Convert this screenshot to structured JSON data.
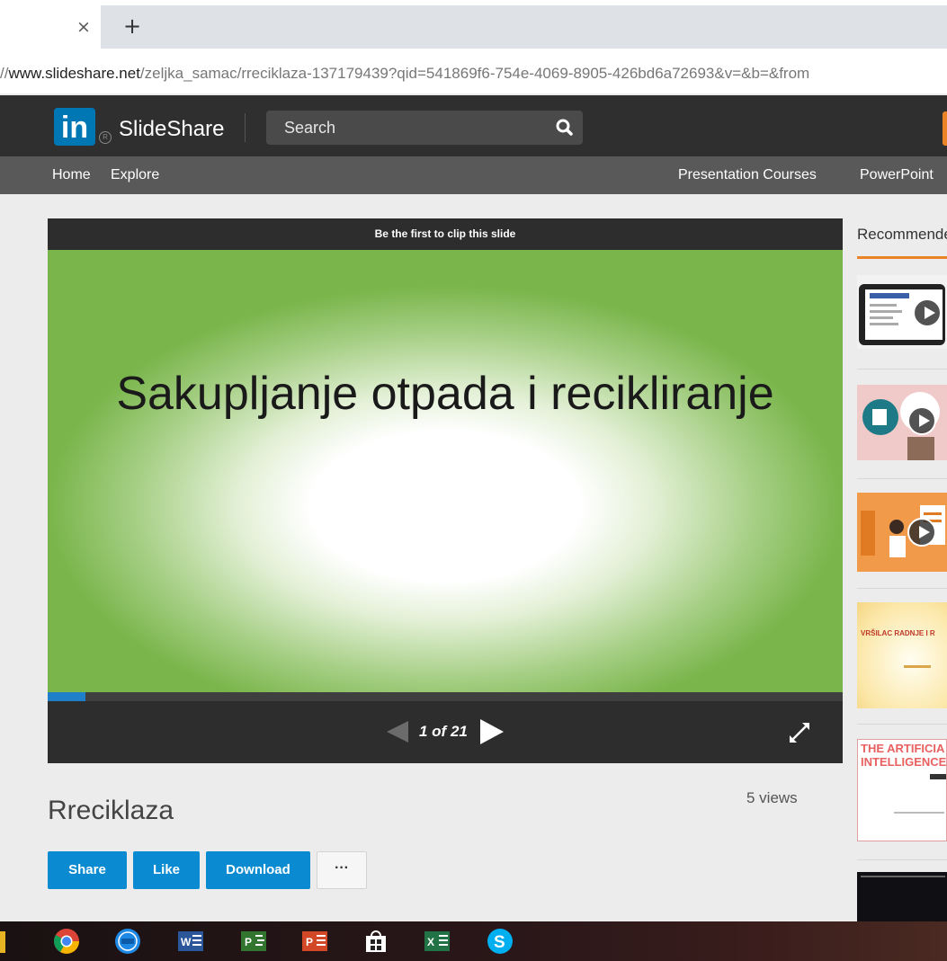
{
  "browser": {
    "tab_close_glyph": "×",
    "new_tab_glyph": "+",
    "url_prefix": "//",
    "url_domain": "www.slideshare.net",
    "url_path": "/zeljka_samac/rreciklaza-137179439?qid=541869f6-754e-4069-8905-426bd6a72693&v=&b=&from"
  },
  "header": {
    "logo_in": "in",
    "logo_reg": "R",
    "brand": "SlideShare",
    "search_placeholder": "Search",
    "nav": {
      "home": "Home",
      "explore": "Explore",
      "presentation_courses": "Presentation Courses",
      "powerpoint": "PowerPoint"
    }
  },
  "player": {
    "clip_label": "Be the first to clip this slide",
    "slide_title": "Sakupljanje otpada i recikliranje",
    "page_counter": "1 of 21",
    "current_page": 1,
    "total_pages": 21
  },
  "document": {
    "title": "Rreciklaza",
    "views": "5 views",
    "buttons": {
      "share": "Share",
      "like": "Like",
      "download": "Download",
      "more": "···"
    }
  },
  "sidebar": {
    "tab_label": "Recommended",
    "items": [
      {
        "type": "video",
        "icon": "tablet-course-thumbnail"
      },
      {
        "type": "video",
        "icon": "office-illustration-thumbnail"
      },
      {
        "type": "video",
        "icon": "person-desk-thumbnail"
      },
      {
        "type": "slide",
        "text": "VRŠILAC RADNJE I R"
      },
      {
        "type": "slide",
        "text": "THE ARTIFICIA INTELLIGENCE"
      },
      {
        "type": "slide",
        "icon": "dark-slide-thumbnail"
      }
    ]
  },
  "taskbar": {
    "icons": [
      "chrome-icon",
      "clock-icon",
      "word-icon",
      "project-icon",
      "powerpoint-icon",
      "store-icon",
      "excel-icon",
      "skype-icon"
    ]
  },
  "colors": {
    "brand_blue": "#0077b5",
    "button_blue": "#0a8ad1",
    "accent_orange": "#e98325",
    "header_dark": "#2f2f2f",
    "subnav_gray": "#595959"
  }
}
